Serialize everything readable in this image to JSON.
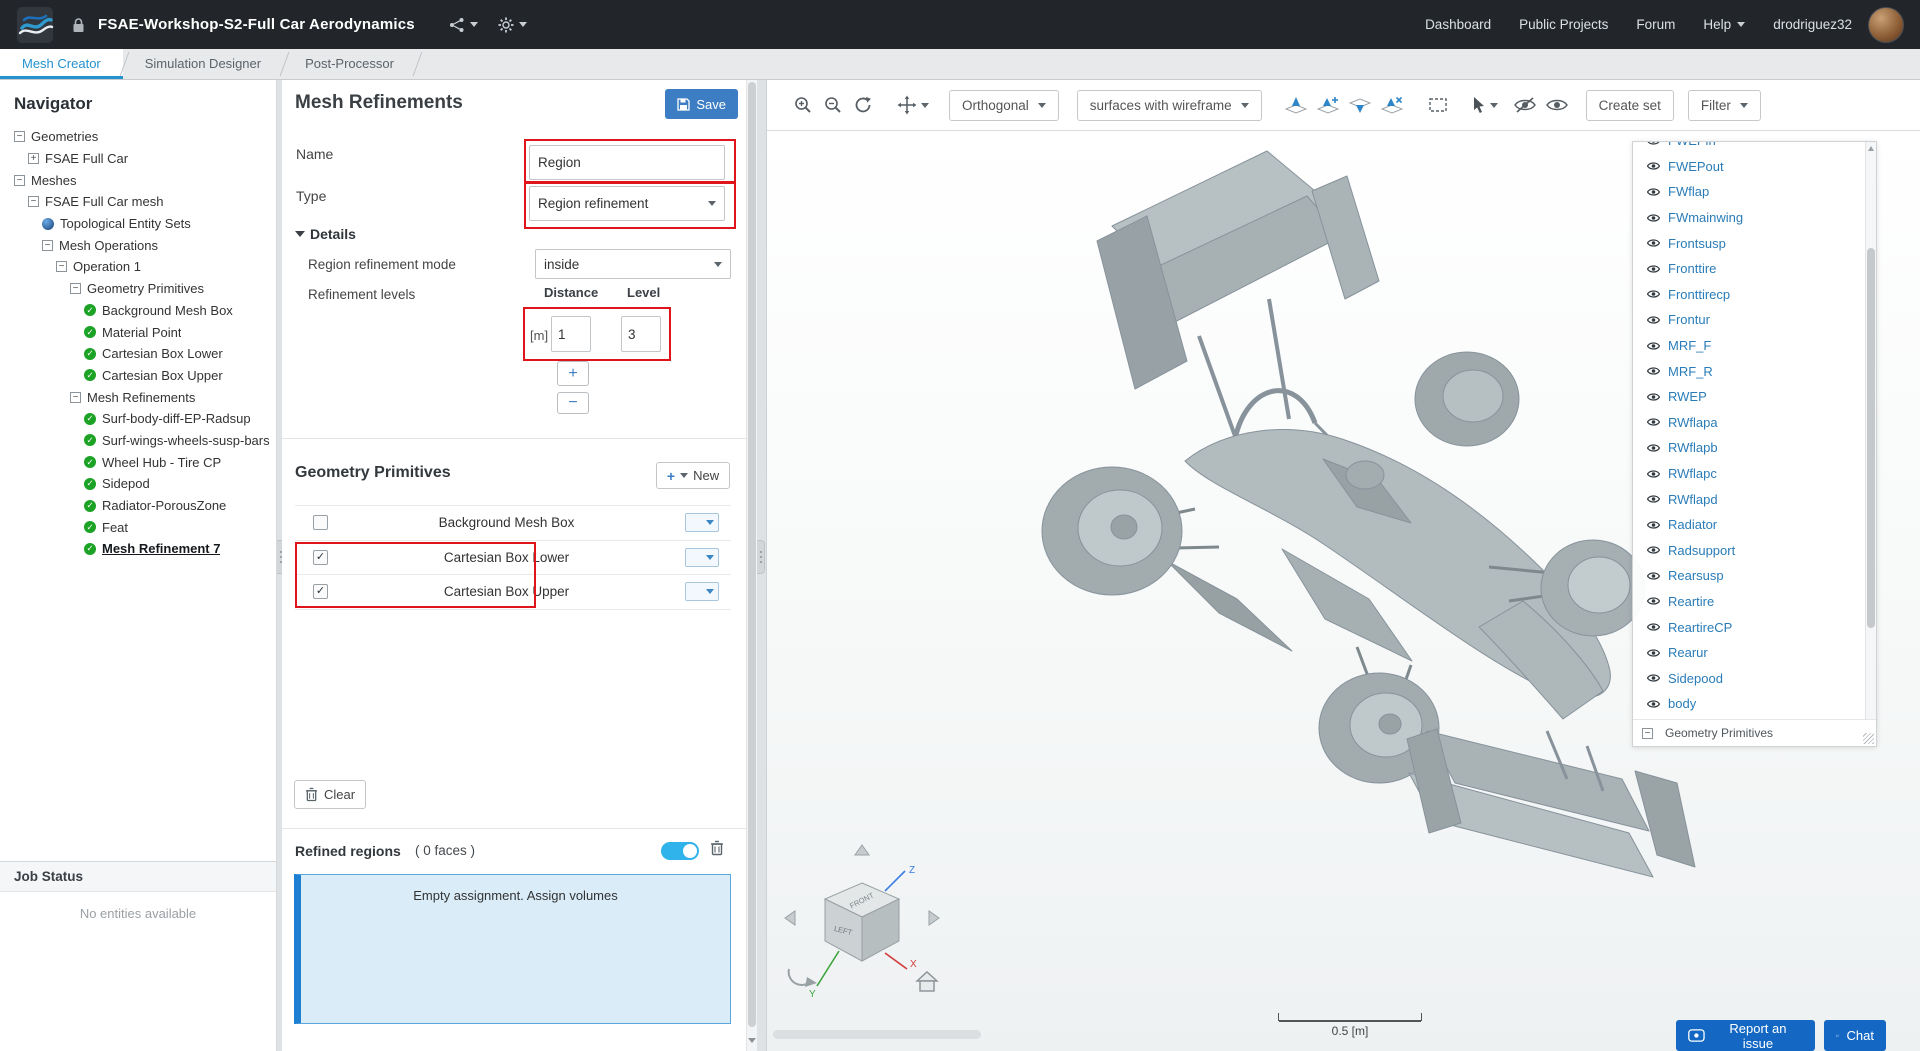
{
  "colors": {
    "accent_blue": "#2492cf",
    "link_blue": "#2a7cb8",
    "save_blue": "#3c7dc4",
    "annotation_red": "#e0151b",
    "check_green": "#1ca224",
    "toggle_blue": "#30b2ea",
    "info_bg": "#d9ecf8",
    "info_border": "#5aa7dd",
    "info_bar": "#1d7fd1",
    "button_blue": "#1468c3"
  },
  "header": {
    "project_title": "FSAE-Workshop-S2-Full Car Aerodynamics",
    "nav_items": [
      {
        "label": "Dashboard"
      },
      {
        "label": "Public Projects"
      },
      {
        "label": "Forum"
      },
      {
        "label": "Help",
        "caret": true
      }
    ],
    "username": "drodriguez32"
  },
  "tabs": [
    {
      "label": "Mesh Creator",
      "active": true
    },
    {
      "label": "Simulation Designer",
      "active": false
    },
    {
      "label": "Post-Processor",
      "active": false
    }
  ],
  "navigator": {
    "title": "Navigator",
    "tree": [
      {
        "label": "Geometries",
        "depth": 0,
        "icon": "minus"
      },
      {
        "label": "FSAE Full Car",
        "depth": 1,
        "icon": "plus"
      },
      {
        "label": "Meshes",
        "depth": 0,
        "icon": "minus"
      },
      {
        "label": "FSAE Full Car mesh",
        "depth": 1,
        "icon": "minus"
      },
      {
        "label": "Topological Entity Sets",
        "depth": 2,
        "icon": "sphere"
      },
      {
        "label": "Mesh Operations",
        "depth": 2,
        "icon": "minus"
      },
      {
        "label": "Operation 1",
        "depth": 3,
        "icon": "minus"
      },
      {
        "label": "Geometry Primitives",
        "depth": 4,
        "icon": "minus"
      },
      {
        "label": "Background Mesh Box",
        "depth": 5,
        "icon": "check"
      },
      {
        "label": "Material Point",
        "depth": 5,
        "icon": "check"
      },
      {
        "label": "Cartesian Box Lower",
        "depth": 5,
        "icon": "check"
      },
      {
        "label": "Cartesian Box Upper",
        "depth": 5,
        "icon": "check"
      },
      {
        "label": "Mesh Refinements",
        "depth": 4,
        "icon": "minus"
      },
      {
        "label": "Surf-body-diff-EP-Radsup",
        "depth": 5,
        "icon": "check"
      },
      {
        "label": "Surf-wings-wheels-susp-bars",
        "depth": 5,
        "icon": "check"
      },
      {
        "label": "Wheel Hub - Tire CP",
        "depth": 5,
        "icon": "check"
      },
      {
        "label": "Sidepod",
        "depth": 5,
        "icon": "check"
      },
      {
        "label": "Radiator-PorousZone",
        "depth": 5,
        "icon": "check"
      },
      {
        "label": "Feat",
        "depth": 5,
        "icon": "check"
      },
      {
        "label": "Mesh Refinement 7",
        "depth": 5,
        "icon": "check",
        "selected": true
      }
    ],
    "job_status": {
      "title": "Job Status",
      "empty_text": "No entities available"
    }
  },
  "panel": {
    "title": "Mesh Refinements",
    "save_label": "Save",
    "name_label": "Name",
    "name_value": "Region",
    "type_label": "Type",
    "type_value": "Region refinement",
    "details": {
      "title": "Details",
      "mode_label": "Region refinement mode",
      "mode_value": "inside",
      "levels_label": "Refinement levels",
      "col_distance": "Distance",
      "col_level": "Level",
      "unit": "[m]",
      "distance_value": "1",
      "level_value": "3",
      "add_symbol": "+",
      "remove_symbol": "−"
    },
    "geometry_primitives": {
      "title": "Geometry Primitives",
      "new_label": "New",
      "rows": [
        {
          "label": "Background Mesh Box",
          "checked": false
        },
        {
          "label": "Cartesian Box Lower",
          "checked": true
        },
        {
          "label": "Cartesian Box Upper",
          "checked": true
        }
      ],
      "clear_label": "Clear"
    },
    "refined_regions": {
      "label": "Refined regions",
      "faces_count": "( 0 faces )",
      "toggle_on": true,
      "empty_message": "Empty assignment. Assign volumes"
    }
  },
  "viewport": {
    "toolbar": {
      "projection_label": "Orthogonal",
      "render_mode_label": "surfaces with wireframe",
      "create_set_label": "Create set",
      "filter_label": "Filter"
    },
    "parts_panel": {
      "items": [
        "FWEPin",
        "FWEPout",
        "FWflap",
        "FWmainwing",
        "Frontsusp",
        "Fronttire",
        "Fronttirecp",
        "Frontur",
        "MRF_F",
        "MRF_R",
        "RWEP",
        "RWflapa",
        "RWflapb",
        "RWflapc",
        "RWflapd",
        "Radiator",
        "Radsupport",
        "Rearsusp",
        "Reartire",
        "ReartireCP",
        "Rearur",
        "Sidepood",
        "body"
      ],
      "footer": "Geometry Primitives"
    },
    "cube_labels": {
      "left": "LEFT",
      "front": "FRONT",
      "x": "X",
      "y": "Y",
      "z": "Z"
    },
    "scale_label": "0.5 [m]",
    "report_issue_label": "Report an issue",
    "chat_label": "Chat"
  }
}
